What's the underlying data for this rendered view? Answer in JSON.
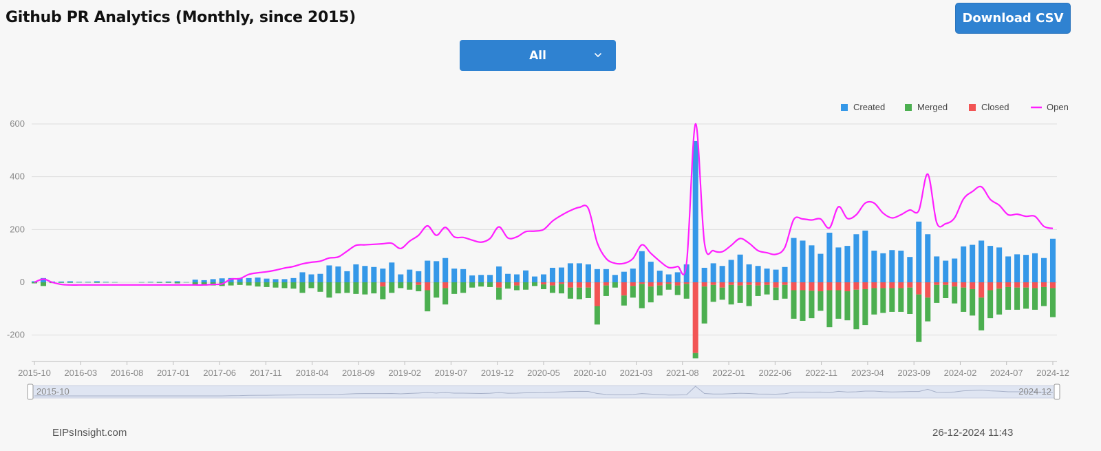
{
  "header": {
    "title": "Github PR Analytics (Monthly, since 2015)",
    "download_label": "Download CSV"
  },
  "filter": {
    "selected": "All"
  },
  "footer": {
    "site": "EIPsInsight.com",
    "timestamp": "26-12-2024 11:43"
  },
  "colors": {
    "created": "#3598e8",
    "merged": "#4caf50",
    "closed": "#f25454",
    "open": "#ff1eff",
    "button": "#2f82d1"
  },
  "chart_data": {
    "type": "bar",
    "stacked": true,
    "legend_position": "top-right",
    "legend": [
      "Created",
      "Merged",
      "Closed",
      "Open"
    ],
    "ylim": [
      -300,
      600
    ],
    "yticks": [
      600,
      400,
      200,
      0,
      -200
    ],
    "grid": true,
    "x_tick_labels": [
      "2015-10",
      "2016-03",
      "2016-08",
      "2017-01",
      "2017-06",
      "2017-11",
      "2018-04",
      "2018-09",
      "2019-02",
      "2019-07",
      "2019-12",
      "2020-05",
      "2020-10",
      "2021-03",
      "2021-08",
      "2022-01",
      "2022-06",
      "2022-11",
      "2023-04",
      "2023-09",
      "2024-02",
      "2024-07",
      "2024-12"
    ],
    "x_start": "2015-10",
    "x_end": "2024-12",
    "slider": {
      "start_label": "2015-10",
      "end_label": "2024-12"
    },
    "series": [
      {
        "name": "Created",
        "values": [
          4,
          16,
          3,
          3,
          4,
          2,
          2,
          4,
          2,
          1,
          0,
          0,
          1,
          2,
          2,
          3,
          4,
          1,
          10,
          8,
          12,
          15,
          16,
          16,
          16,
          18,
          14,
          12,
          12,
          16,
          38,
          30,
          32,
          64,
          60,
          42,
          68,
          62,
          58,
          52,
          75,
          30,
          48,
          42,
          82,
          80,
          92,
          52,
          50,
          26,
          28,
          28,
          60,
          32,
          30,
          45,
          22,
          30,
          55,
          56,
          72,
          72,
          68,
          50,
          50,
          28,
          40,
          52,
          118,
          78,
          44,
          30,
          38,
          68,
          535,
          55,
          72,
          62,
          85,
          105,
          68,
          62,
          52,
          48,
          58,
          168,
          158,
          140,
          108,
          188,
          132,
          138,
          182,
          196,
          120,
          110,
          122,
          120,
          96,
          230,
          182,
          98,
          82,
          90,
          136,
          142,
          158,
          138,
          132,
          98,
          106,
          104,
          110,
          92,
          165
        ]
      },
      {
        "name": "Merged",
        "values": [
          -4,
          -14,
          -3,
          -2,
          -2,
          -1,
          -1,
          -2,
          -1,
          -1,
          0,
          0,
          -1,
          -1,
          -2,
          -2,
          -4,
          -1,
          -12,
          -10,
          -12,
          -14,
          -12,
          -10,
          -12,
          -16,
          -18,
          -20,
          -22,
          -24,
          -40,
          -22,
          -36,
          -58,
          -42,
          -40,
          -44,
          -46,
          -42,
          -48,
          -40,
          -22,
          -28,
          -24,
          -80,
          -58,
          -62,
          -44,
          -40,
          -20,
          -16,
          -18,
          -46,
          -24,
          -18,
          -28,
          -14,
          -18,
          -28,
          -36,
          -42,
          -44,
          -40,
          -70,
          -40,
          -20,
          -38,
          -44,
          -92,
          -60,
          -38,
          -22,
          -36,
          -56,
          -20,
          -140,
          -64,
          -46,
          -74,
          -66,
          -80,
          -40,
          -36,
          -48,
          -52,
          -108,
          -116,
          -104,
          -74,
          -140,
          -108,
          -110,
          -150,
          -136,
          -100,
          -94,
          -90,
          -90,
          -100,
          -180,
          -90,
          -68,
          -50,
          -64,
          -92,
          -100,
          -124,
          -106,
          -98,
          -86,
          -84,
          -80,
          -82,
          -72,
          -110
        ]
      },
      {
        "name": "Closed",
        "values": [
          0,
          0,
          0,
          0,
          0,
          0,
          0,
          0,
          0,
          0,
          0,
          0,
          0,
          0,
          0,
          0,
          0,
          0,
          0,
          0,
          0,
          0,
          0,
          0,
          0,
          0,
          0,
          0,
          0,
          0,
          0,
          0,
          0,
          0,
          0,
          0,
          0,
          0,
          0,
          -16,
          0,
          0,
          0,
          -10,
          -30,
          0,
          -22,
          0,
          0,
          0,
          0,
          0,
          -20,
          0,
          -12,
          0,
          0,
          -8,
          -12,
          -6,
          -20,
          -20,
          -20,
          -90,
          -12,
          0,
          -50,
          -14,
          -6,
          -16,
          -12,
          -6,
          -12,
          -6,
          -268,
          -16,
          -10,
          -20,
          -10,
          -12,
          -10,
          -12,
          -10,
          -20,
          -10,
          -30,
          -30,
          -32,
          -34,
          -30,
          -30,
          -34,
          -28,
          -26,
          -22,
          -22,
          -22,
          -22,
          -20,
          -46,
          -58,
          -10,
          -10,
          -16,
          -20,
          -26,
          -58,
          -30,
          -24,
          -18,
          -20,
          -20,
          -22,
          -18,
          -22
        ]
      },
      {
        "name": "Open",
        "values": [
          0,
          12,
          0,
          -8,
          -10,
          -10,
          -10,
          -10,
          -10,
          -10,
          -10,
          -10,
          -10,
          -10,
          -10,
          -10,
          -10,
          -10,
          -10,
          -10,
          -8,
          -6,
          12,
          14,
          30,
          36,
          40,
          46,
          54,
          60,
          70,
          76,
          80,
          92,
          96,
          118,
          140,
          142,
          144,
          146,
          148,
          128,
          156,
          178,
          214,
          178,
          208,
          172,
          170,
          160,
          152,
          166,
          210,
          168,
          172,
          192,
          194,
          200,
          232,
          254,
          272,
          284,
          280,
          150,
          90,
          72,
          72,
          90,
          142,
          110,
          80,
          56,
          60,
          72,
          600,
          150,
          120,
          116,
          140,
          166,
          148,
          120,
          112,
          106,
          132,
          238,
          240,
          236,
          240,
          206,
          286,
          242,
          256,
          300,
          300,
          262,
          244,
          256,
          274,
          272,
          410,
          226,
          222,
          244,
          316,
          344,
          362,
          314,
          292,
          256,
          258,
          250,
          250,
          212,
          204
        ]
      }
    ]
  }
}
